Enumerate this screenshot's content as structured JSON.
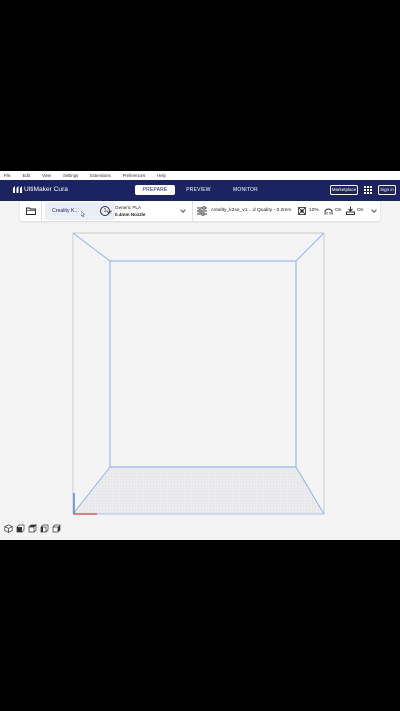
{
  "menubar": {
    "items": [
      "File",
      "Edit",
      "View",
      "Settings",
      "Extensions",
      "Preferences",
      "Help"
    ]
  },
  "header": {
    "app_title": "UltiMaker Cura",
    "tabs": [
      {
        "label": "PREPARE",
        "active": true
      },
      {
        "label": "PREVIEW",
        "active": false
      },
      {
        "label": "MONITOR",
        "active": false
      }
    ],
    "marketplace_label": "Marketplace",
    "signin_label": "Sign in"
  },
  "toolbar": {
    "printer_label": "Creality K...",
    "extruder_number": "1",
    "material_name": "Generic PLA",
    "nozzle_size": "0.4mm Nozzle",
    "profile_name": "creality_k2se_v1 ...d Quality - 0.2mm",
    "infill_value": "10%",
    "support_value": "On",
    "adhesion_value": "On"
  },
  "icons": {
    "folder": "folder-icon",
    "chevron": "chevron-down-icon",
    "settings": "sliders-icon",
    "infill": "infill-icon",
    "support": "support-icon",
    "adhesion": "adhesion-icon",
    "apps": "apps-grid-icon",
    "views": [
      "view-3d-icon",
      "view-front-icon",
      "view-top-icon",
      "view-left-icon",
      "view-right-icon"
    ]
  },
  "colors": {
    "header_bg": "#1b2460",
    "accent_blue": "#3a6fd8",
    "viewport_bg": "#f4f4f5",
    "build_volume_line": "#8fb0e8"
  }
}
